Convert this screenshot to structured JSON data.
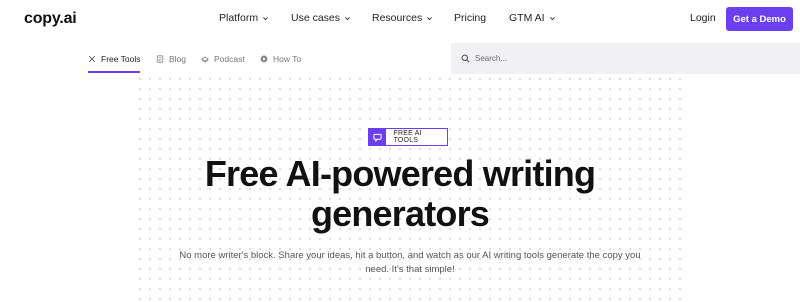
{
  "brand": {
    "logo": "copy.ai",
    "accent_color": "#6b3ef0"
  },
  "nav": {
    "items": [
      {
        "label": "Platform",
        "has_dropdown": true
      },
      {
        "label": "Use cases",
        "has_dropdown": true
      },
      {
        "label": "Resources",
        "has_dropdown": true
      },
      {
        "label": "Pricing",
        "has_dropdown": false
      },
      {
        "label": "GTM AI",
        "has_dropdown": true
      }
    ],
    "login": "Login",
    "cta": "Get a Demo"
  },
  "subnav": {
    "items": [
      {
        "label": "Free Tools",
        "icon": "tools-icon",
        "active": true
      },
      {
        "label": "Blog",
        "icon": "blog-icon",
        "active": false
      },
      {
        "label": "Podcast",
        "icon": "podcast-icon",
        "active": false
      },
      {
        "label": "How To",
        "icon": "how-to-icon",
        "active": false
      }
    ],
    "search_placeholder": "Search..."
  },
  "hero": {
    "badge": "FREE AI TOOLS",
    "headline_line1": "Free AI-powered writing",
    "headline_line2": "generators",
    "subtext_line1": "No more writer's block. Share your ideas, hit a button, and watch as our AI writing tools generate the copy you",
    "subtext_line2": "need. It's that simple!"
  }
}
